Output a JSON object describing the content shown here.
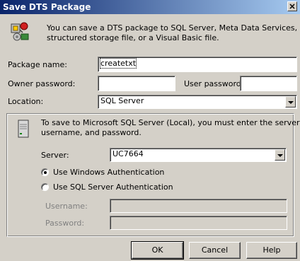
{
  "window": {
    "title": "Save DTS Package"
  },
  "intro": {
    "text_line1": "You can save a DTS package to SQL Server, Meta Data Services, a",
    "text_line2": "structured storage file, or a Visual Basic file."
  },
  "form": {
    "package_name_label": "Package name:",
    "package_name_value": "createtxt",
    "owner_password_label": "Owner password:",
    "owner_password_value": "",
    "user_password_label": "User password:",
    "user_password_value": "",
    "location_label": "Location:",
    "location_value": "SQL Server"
  },
  "server_group": {
    "info_line1": "To save to Microsoft SQL Server (Local), you must enter the server,",
    "info_line2": "username, and password.",
    "server_label": "Server:",
    "server_value": "UC7664",
    "auth_windows_label": "Use Windows Authentication",
    "auth_sql_label": "Use SQL Server Authentication",
    "selected_auth": "windows",
    "username_label": "Username:",
    "username_value": "",
    "password_label": "Password:",
    "password_value": ""
  },
  "buttons": {
    "ok": "OK",
    "cancel": "Cancel",
    "help": "Help"
  },
  "icons": {
    "package": "dts-package-icon",
    "server": "server-icon",
    "close": "close-icon"
  }
}
